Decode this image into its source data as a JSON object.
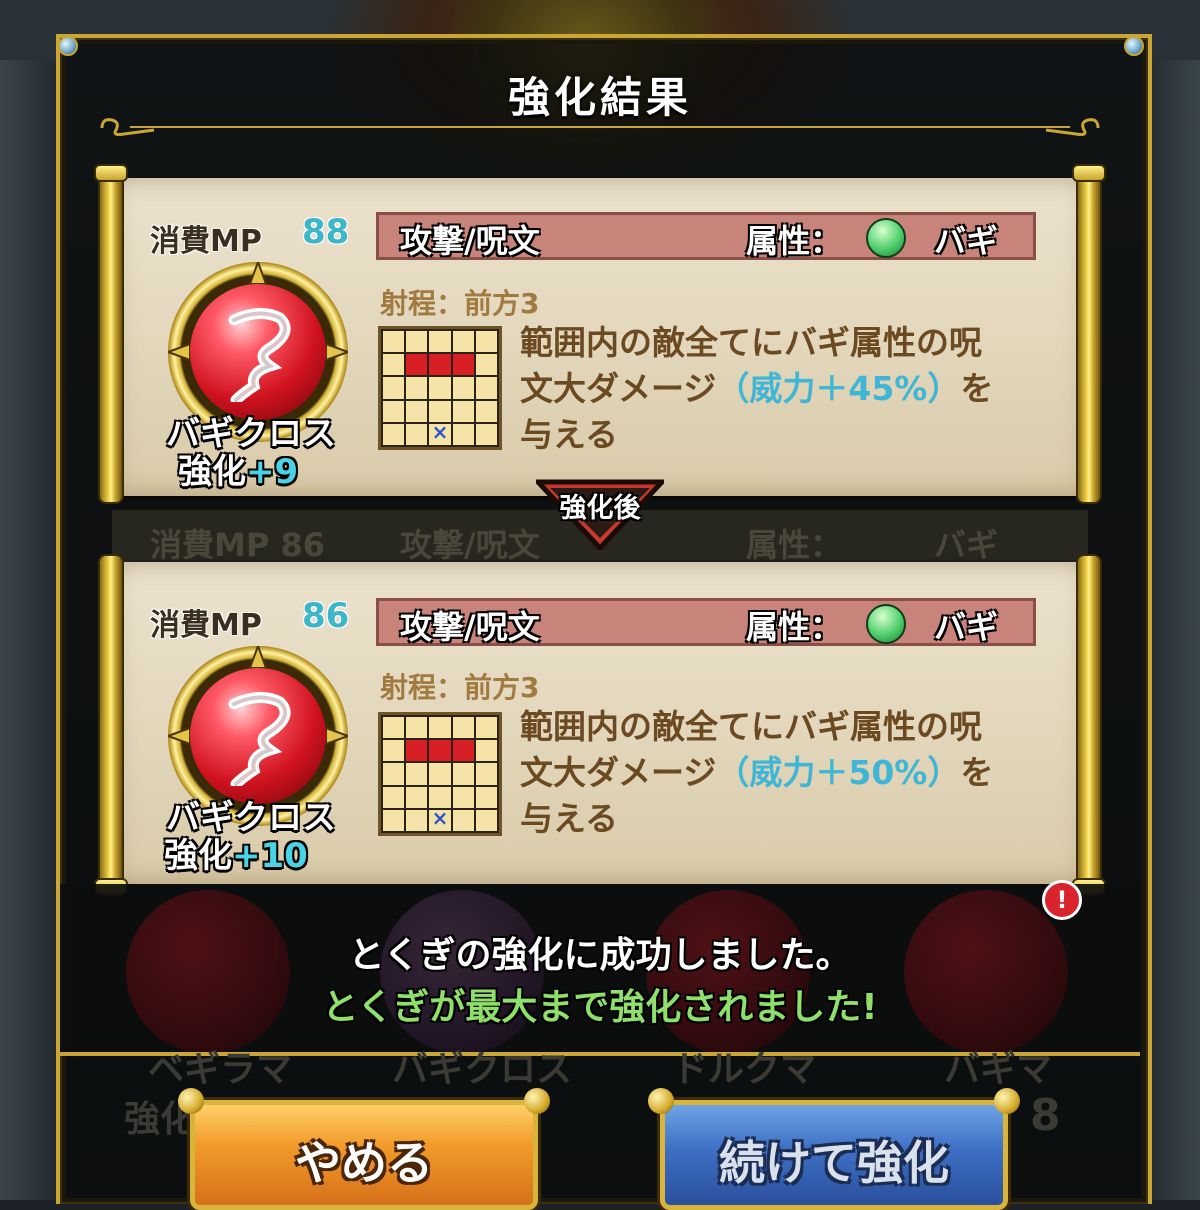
{
  "dialog": {
    "title": "強化結果"
  },
  "divider_label": "強化後",
  "before": {
    "mp_label": "消費MP",
    "mp_value": "88",
    "type": "攻撃/呪文",
    "attr_label": "属性：",
    "attr_value": "バギ",
    "range": "射程：前方3",
    "desc_line1": "範囲内の敵全てにバギ属性の呪",
    "desc_line2_pre": "文大ダメージ",
    "desc_highlight": "（威力＋45%）",
    "desc_line2_post": "を",
    "desc_line3": "与える",
    "skill_name": "バギクロス",
    "enhance_label": "強化",
    "enhance_value": "+9",
    "icon": "baguicross-icon"
  },
  "after": {
    "mp_label": "消費MP",
    "mp_value": "86",
    "type": "攻撃/呪文",
    "attr_label": "属性：",
    "attr_value": "バギ",
    "range": "射程：前方3",
    "desc_line1": "範囲内の敵全てにバギ属性の呪",
    "desc_line2_pre": "文大ダメージ",
    "desc_highlight": "（威力＋50%）",
    "desc_line2_post": "を",
    "desc_line3": "与える",
    "skill_name": "バギクロス",
    "enhance_label": "強化",
    "enhance_value": "+10",
    "icon": "baguicross-icon"
  },
  "ghost_row": {
    "mp_label": "消費MP",
    "mp_value": "86",
    "type": "攻撃/呪文",
    "attr": "属性：",
    "attr_value": "バギ"
  },
  "messages": {
    "success": "とくぎの強化に成功しました。",
    "maxed": "とくぎが最大まで強化されました!"
  },
  "background_labels": {
    "item1": "ベギラマ",
    "item2": "バギクロス",
    "item3": "ドルクマ",
    "item4": "バギマ",
    "item1_enh": "強化",
    "item4_enh": "8",
    "alert": "!"
  },
  "buttons": {
    "stop": "やめる",
    "continue": "続けて強化"
  },
  "colors": {
    "frame_gold": "#c9a636",
    "parchment": "#e2d6bb",
    "type_bar": "#c8837a",
    "highlight_cyan": "#40b6d6",
    "maxed_green": "#8fe06a",
    "stop_orange": "#f29b2a",
    "continue_blue": "#3e6fc4"
  }
}
